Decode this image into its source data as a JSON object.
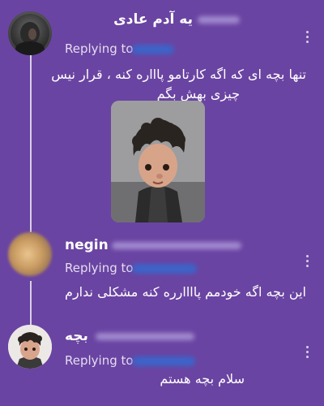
{
  "tweets": [
    {
      "name": "یه آدم عادی",
      "replying_prefix": "Replying to",
      "text_lines": [
        "تنها بچه ای که اگه کارتامو پاااره کنه ، قرار نیس",
        "چیزی بهش بگم"
      ]
    },
    {
      "name": "negin",
      "replying_prefix": "Replying to",
      "text_lines": [
        "این بچه اگه خودمم پاااارره کنه مشکلی ندارم"
      ]
    },
    {
      "name": "بچه",
      "replying_prefix": "Replying to",
      "text_lines": [
        "سلام بچه هستم"
      ]
    }
  ],
  "icons": {
    "more": "more-vertical-icon"
  }
}
